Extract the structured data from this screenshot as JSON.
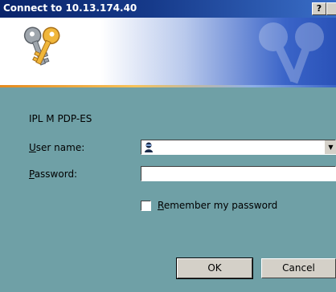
{
  "window": {
    "title": "Connect to 10.13.174.40",
    "help_label": "?"
  },
  "dialog": {
    "realm": "IPL M PDP-ES",
    "username_label": "User name:",
    "username_accesskey": "U",
    "username_rest": "ser name:",
    "username_value": "",
    "password_label": "Password:",
    "password_accesskey": "P",
    "password_rest": "assword:",
    "password_value": "",
    "remember_accesskey": "R",
    "remember_rest": "emember my password",
    "remember_checked": false,
    "ok_label": "OK",
    "cancel_label": "Cancel"
  },
  "colors": {
    "title_bar": "#0a246a",
    "dialog_bg": "#6fa0a6",
    "banner_stripe": "#e58a1e"
  },
  "icons": [
    "keys-icon",
    "user-icon",
    "chevron-down-icon",
    "close-icon"
  ]
}
